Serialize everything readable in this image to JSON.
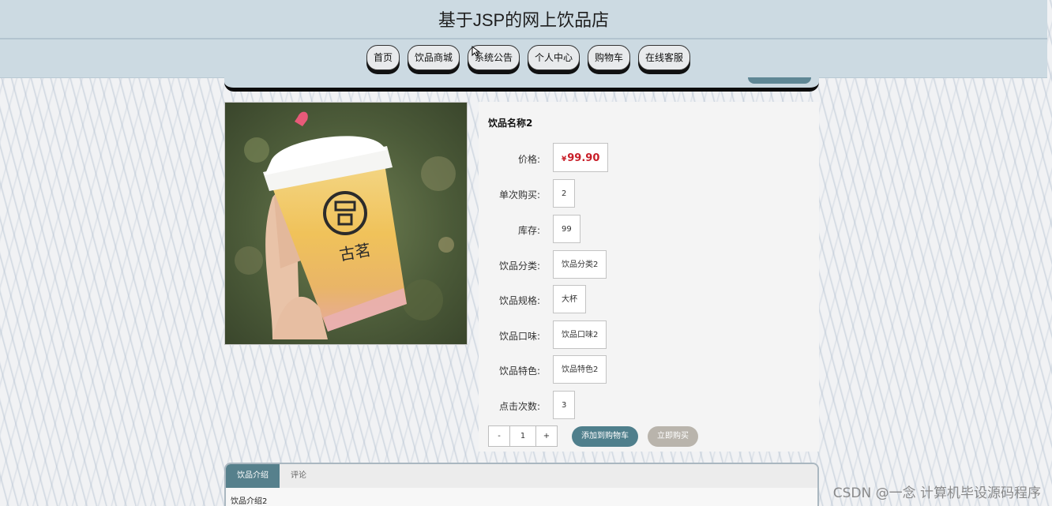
{
  "site": {
    "title": "基于JSP的网上饮品店"
  },
  "nav": {
    "items": [
      {
        "label": "首页"
      },
      {
        "label": "饮品商城"
      },
      {
        "label": "系统公告"
      },
      {
        "label": "个人中心"
      },
      {
        "label": "购物车"
      },
      {
        "label": "在线客服"
      }
    ]
  },
  "product": {
    "name": "饮品名称2",
    "image_icon": "product-photo",
    "fields": {
      "price": {
        "label": "价格:",
        "currency": "¥",
        "value": "99.90"
      },
      "single_purchase": {
        "label": "单次购买:",
        "value": "2"
      },
      "stock": {
        "label": "库存:",
        "value": "99"
      },
      "category": {
        "label": "饮品分类:",
        "value": "饮品分类2"
      },
      "spec": {
        "label": "饮品规格:",
        "value": "大杯"
      },
      "flavor": {
        "label": "饮品口味:",
        "value": "饮品口味2"
      },
      "feature": {
        "label": "饮品特色:",
        "value": "饮品特色2"
      },
      "clicks": {
        "label": "点击次数:",
        "value": "3"
      }
    },
    "quantity": {
      "minus": "-",
      "value": "1",
      "plus": "+"
    },
    "actions": {
      "add_to_cart": "添加到购物车",
      "buy_now": "立即购买"
    }
  },
  "tabs": {
    "items": [
      {
        "label": "饮品介绍"
      },
      {
        "label": "评论"
      }
    ],
    "content": "饮品介绍2"
  },
  "watermark": "CSDN @一念 计算机毕设源码程序",
  "colors": {
    "header_bg": "#ccdae2",
    "accent": "#4f7f8c",
    "price": "#c81e28",
    "muted_button": "#b9b4ac"
  }
}
